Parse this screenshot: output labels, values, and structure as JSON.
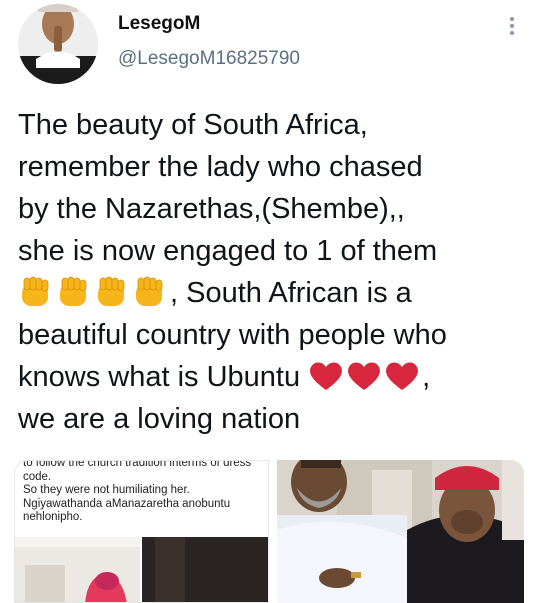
{
  "author": {
    "display_name": "LesegoM",
    "handle": "@LesegoM16825790"
  },
  "tweet": {
    "lines": [
      "The beauty of South Africa,",
      "remember the lady who chased",
      "by the Nazarethas,(Shembe),,",
      "she is now engaged to 1 of them",
      ", South African is a",
      "beautiful country with people who",
      "knows what is Ubuntu",
      ",",
      "we are a loving nation"
    ],
    "emoji_fist": "raised-fist-emoji",
    "emoji_heart": "red-heart-emoji"
  },
  "media": {
    "left_caption": [
      "to follow the church tradition interms of dress",
      "code.",
      "So they were not humiliating her.",
      "Ngiyawathanda aManazaretha anobuntu",
      "nehlonipho."
    ]
  },
  "colors": {
    "handle": "#5b7083",
    "text": "#0f1419",
    "heart": "#d7263d",
    "fist": "#f7b51c"
  }
}
